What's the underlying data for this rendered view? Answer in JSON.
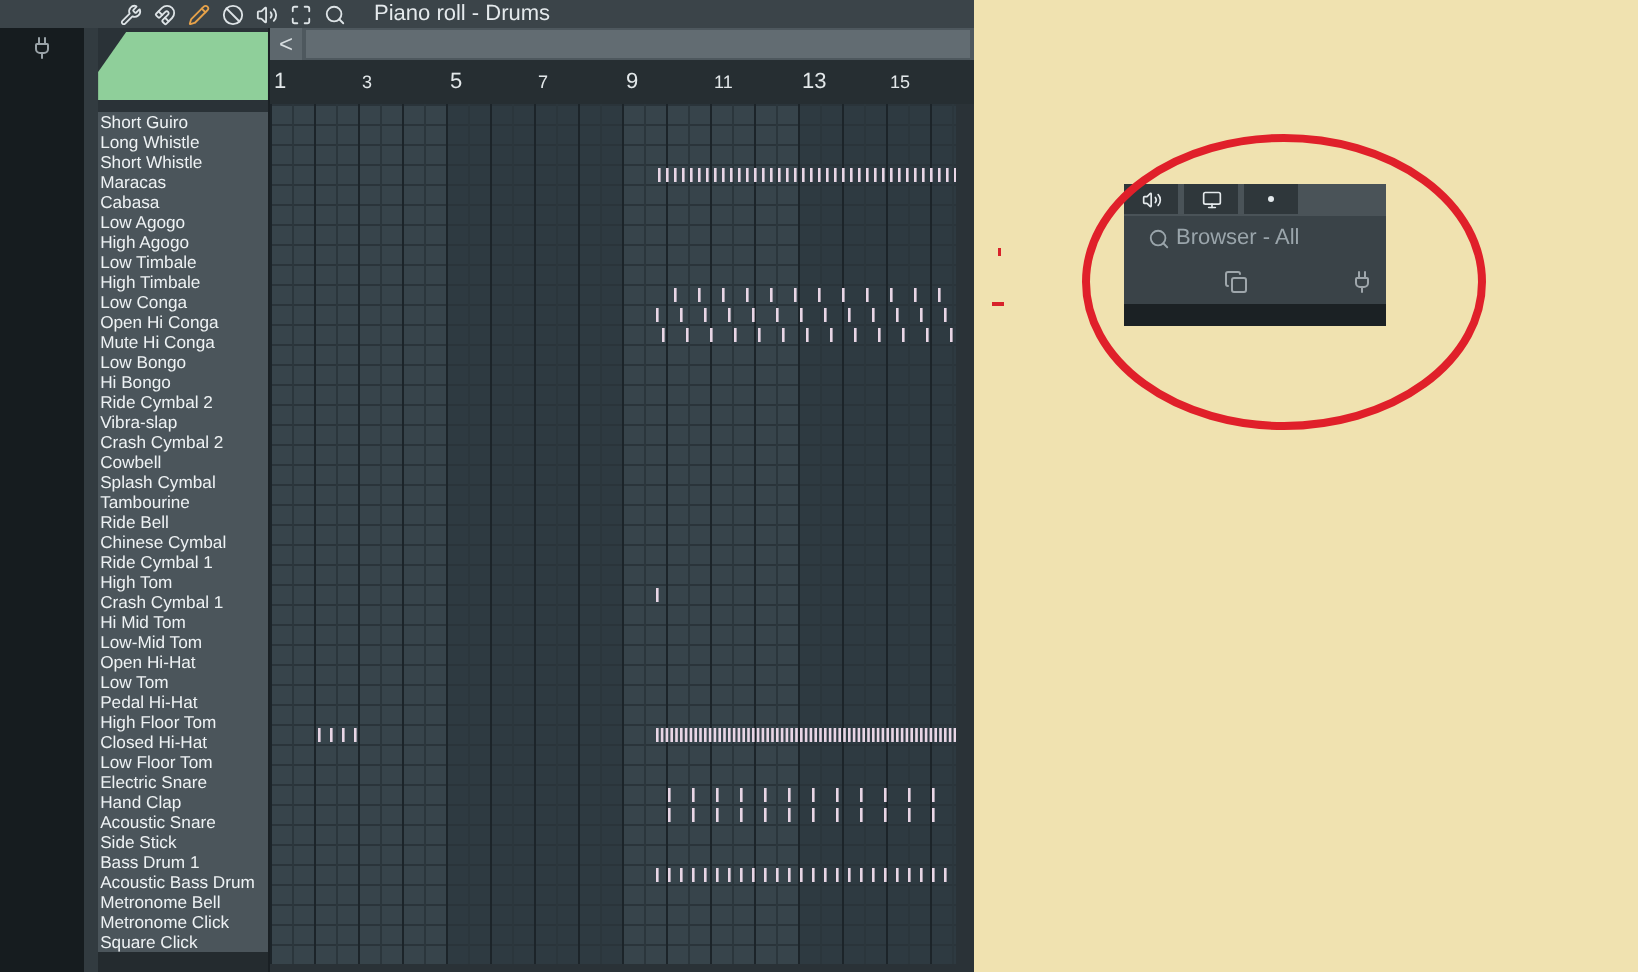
{
  "toolbar": {
    "title": "Piano roll - Drums"
  },
  "scroll_button": "<",
  "ruler": {
    "bar_numbers": [
      "1",
      "3",
      "5",
      "7",
      "9",
      "11",
      "13",
      "15"
    ]
  },
  "keys": [
    "Short Guiro",
    "Long Whistle",
    "Short Whistle",
    "Maracas",
    "Cabasa",
    "Low Agogo",
    "High Agogo",
    "Low Timbale",
    "High Timbale",
    "Low Conga",
    "Open Hi Conga",
    "Mute Hi Conga",
    "Low Bongo",
    "Hi Bongo",
    "Ride Cymbal 2",
    "Vibra-slap",
    "Crash Cymbal 2",
    "Cowbell",
    "Splash Cymbal",
    "Tambourine",
    "Ride Bell",
    "Chinese Cymbal",
    "Ride Cymbal 1",
    "High Tom",
    "Crash Cymbal 1",
    "Hi Mid Tom",
    "Low-Mid Tom",
    "Open Hi-Hat",
    "Low Tom",
    "Pedal Hi-Hat",
    "High Floor Tom",
    "Closed Hi-Hat",
    "Low Floor Tom",
    "Electric Snare",
    "Hand Clap",
    "Acoustic Snare",
    "Side Stick",
    "Bass Drum 1",
    "Acoustic Bass Drum",
    "Metronome Bell",
    "Metronome Click",
    "Square Click"
  ],
  "browser_inset": {
    "label": "Browser - All"
  }
}
